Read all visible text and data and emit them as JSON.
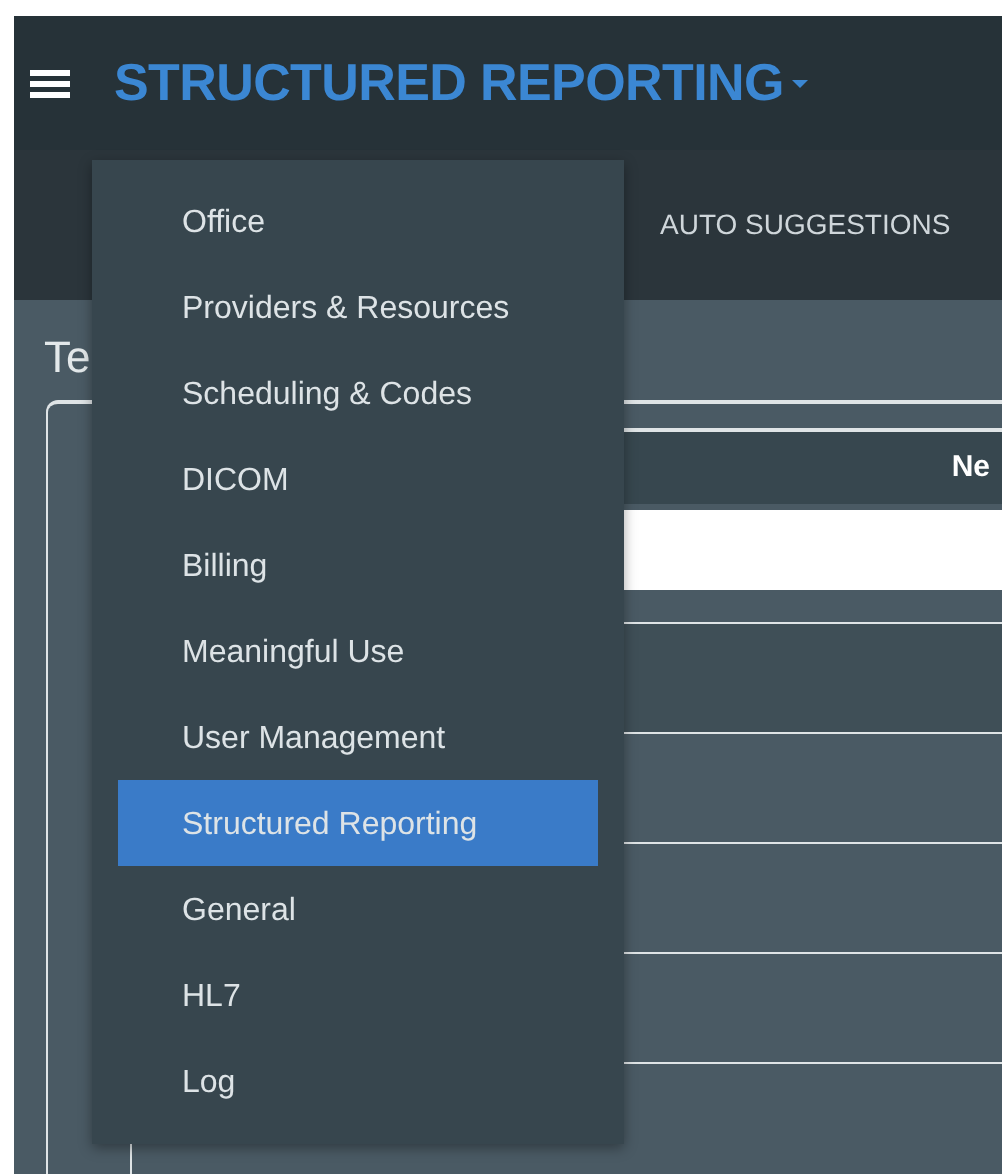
{
  "header": {
    "title": "STRUCTURED REPORTING"
  },
  "nav": {
    "tabs": [
      {
        "label": "AUTO SUGGESTIONS"
      }
    ]
  },
  "page": {
    "title": "Te"
  },
  "table": {
    "columns": [
      "Ne"
    ]
  },
  "menu": {
    "items": [
      {
        "label": "Office",
        "selected": false
      },
      {
        "label": "Providers & Resources",
        "selected": false
      },
      {
        "label": "Scheduling & Codes",
        "selected": false
      },
      {
        "label": "DICOM",
        "selected": false
      },
      {
        "label": "Billing",
        "selected": false
      },
      {
        "label": "Meaningful Use",
        "selected": false
      },
      {
        "label": "User Management",
        "selected": false
      },
      {
        "label": "Structured Reporting",
        "selected": true
      },
      {
        "label": "General",
        "selected": false
      },
      {
        "label": "HL7",
        "selected": false
      },
      {
        "label": "Log",
        "selected": false
      }
    ]
  }
}
